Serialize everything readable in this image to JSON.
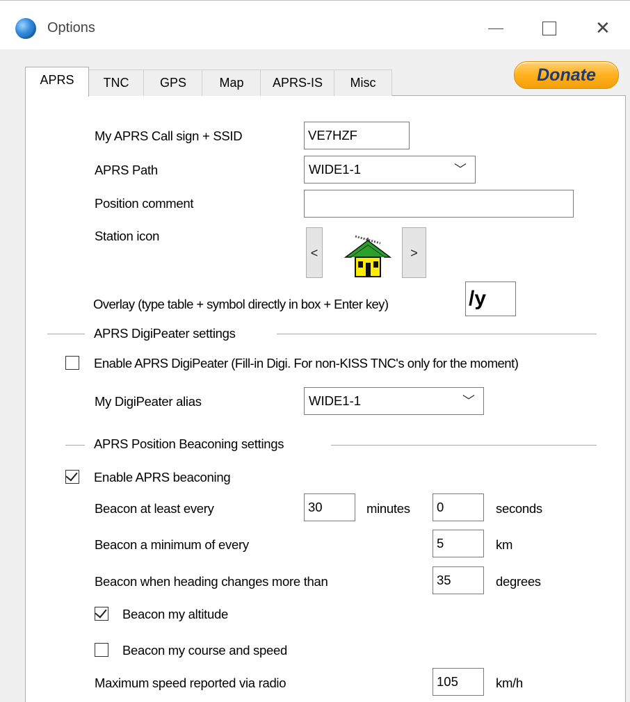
{
  "window": {
    "title": "Options",
    "app_icon": "globe-icon",
    "controls": {
      "minimize": "minimize-icon",
      "maximize": "maximize-icon",
      "close": "close-icon"
    }
  },
  "tabs": [
    "APRS",
    "TNC",
    "GPS",
    "Map",
    "APRS-IS",
    "Misc"
  ],
  "active_tab": "APRS",
  "donate_label": "Donate",
  "station": {
    "callsign_label": "My APRS Call sign + SSID",
    "callsign_value": "VE7HZF",
    "path_label": "APRS Path",
    "path_value": "WIDE1-1",
    "comment_label": "Position comment",
    "comment_value": "",
    "icon_label": "Station icon",
    "icon_prev": "<",
    "icon_next": ">",
    "icon_symbol": "house-with-antenna-icon",
    "overlay_label": "Overlay (type table + symbol directly in box + Enter key)",
    "overlay_value": "/y"
  },
  "digipeater": {
    "section_label": "APRS DigiPeater settings",
    "enable_label": "Enable APRS DigiPeater (Fill-in Digi. For non-KISS TNC's only for the moment)",
    "enabled": false,
    "alias_label": "My DigiPeater alias",
    "alias_value": "WIDE1-1"
  },
  "beaconing": {
    "section_label": "APRS Position Beaconing settings",
    "enable_label": "Enable APRS beaconing",
    "enabled": true,
    "every_label": "Beacon at least every",
    "minutes_value": "30",
    "minutes_unit": "minutes",
    "seconds_value": "0",
    "seconds_unit": "seconds",
    "min_distance_label": "Beacon a minimum of every",
    "min_distance_value": "5",
    "min_distance_unit": "km",
    "heading_label": "Beacon when heading changes more than",
    "heading_value": "35",
    "heading_unit": "degrees",
    "altitude_label": "Beacon my altitude",
    "altitude_enabled": true,
    "course_label": "Beacon my course and speed",
    "course_enabled": false,
    "max_speed_label": "Maximum speed reported via radio",
    "max_speed_value": "105",
    "max_speed_unit": "km/h"
  }
}
